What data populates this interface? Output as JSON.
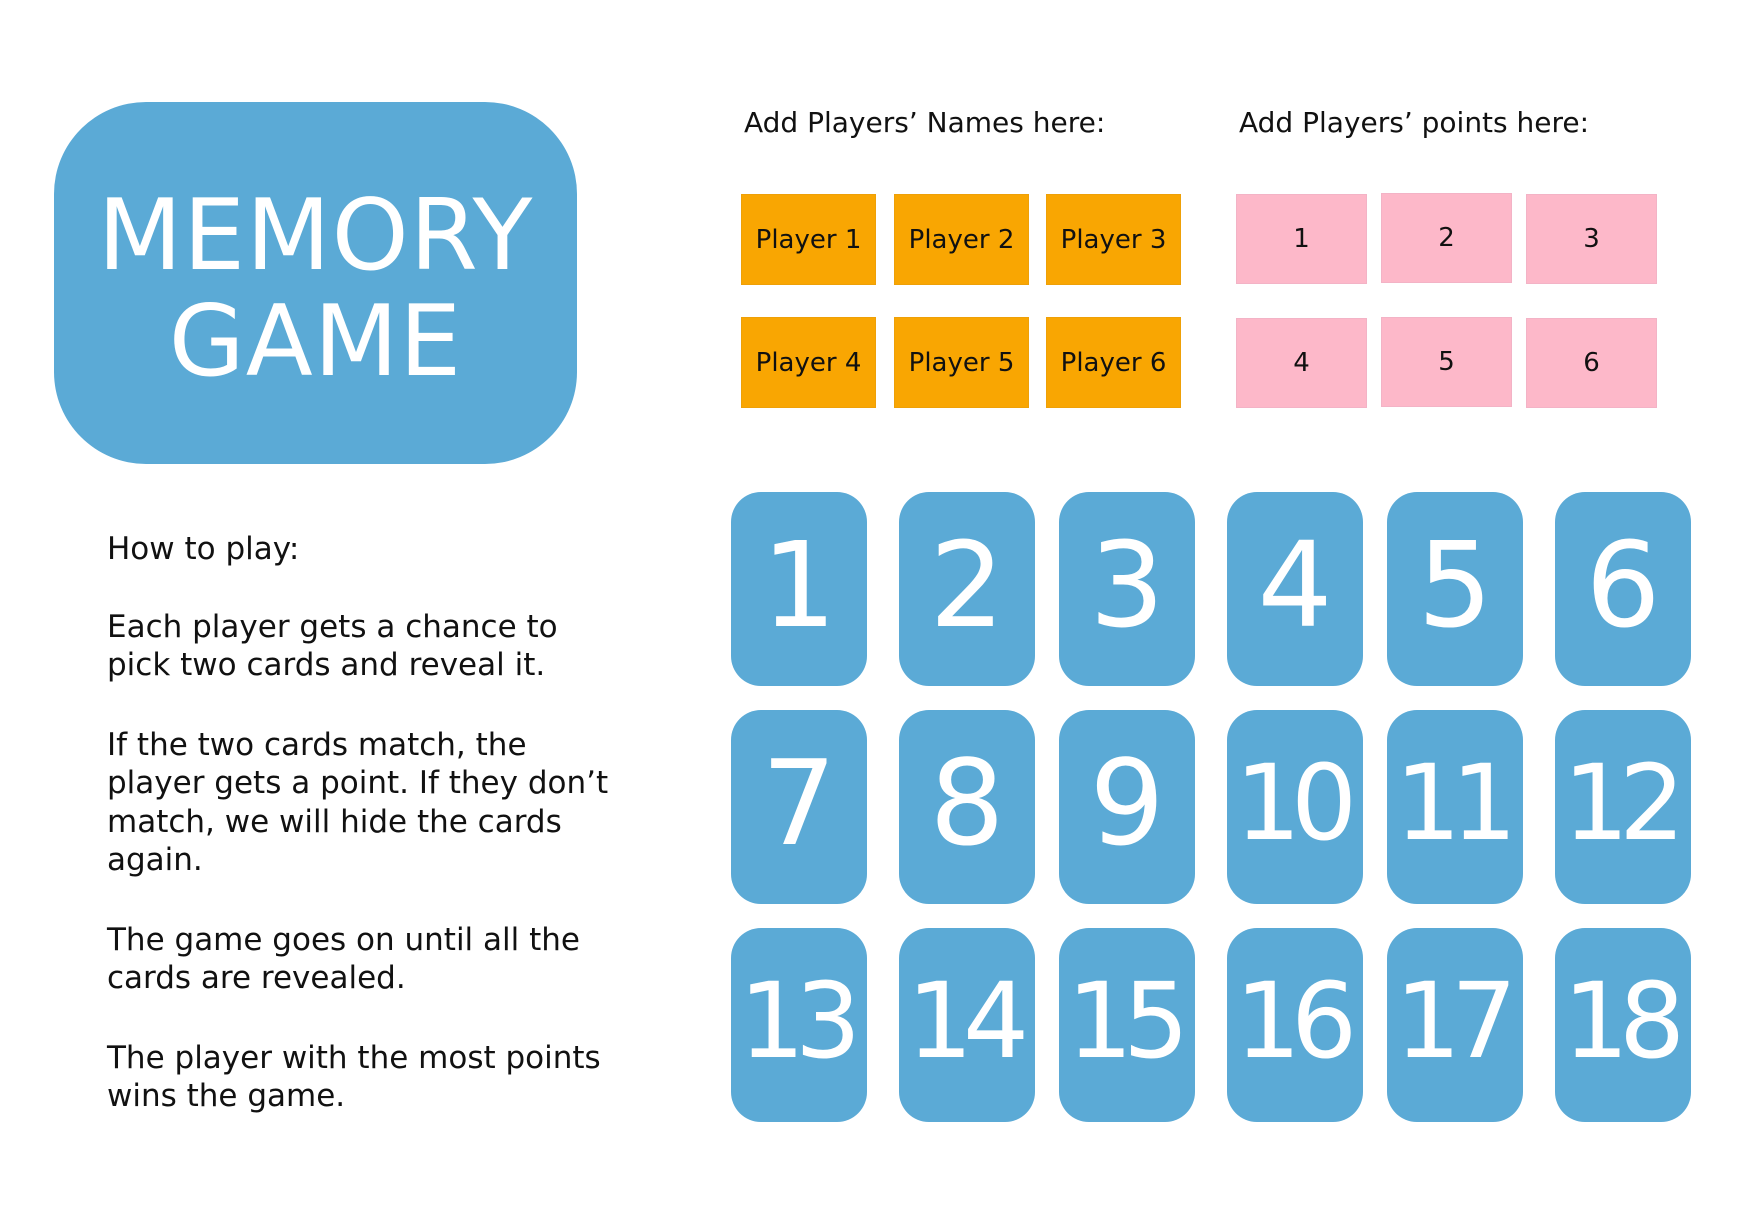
{
  "title": {
    "line1": "MEMORY",
    "line2": "GAME"
  },
  "colors": {
    "card_blue": "#5BAAD6",
    "name_box_orange": "#F9A602",
    "point_box_pink": "#FDB8C9",
    "text_dark": "#111111",
    "text_light": "#FFFFFF"
  },
  "players": {
    "names_header": "Add Players’ Names here:",
    "points_header": "Add Players’ points here:",
    "names": [
      "Player 1",
      "Player 2",
      "Player 3",
      "Player 4",
      "Player 5",
      "Player 6"
    ],
    "points": [
      "1",
      "2",
      "3",
      "4",
      "5",
      "6"
    ]
  },
  "instructions": {
    "heading": "How to play:",
    "paragraphs": [
      "Each player gets a chance to pick two cards and reveal it.",
      "If the two cards match, the player gets a point. If they don’t match, we will hide the cards again.",
      "The game goes on until all the cards are revealed.",
      "The player with the most points wins the game."
    ]
  },
  "cards": [
    "1",
    "2",
    "3",
    "4",
    "5",
    "6",
    "7",
    "8",
    "9",
    "10",
    "11",
    "12",
    "13",
    "14",
    "15",
    "16",
    "17",
    "18"
  ]
}
